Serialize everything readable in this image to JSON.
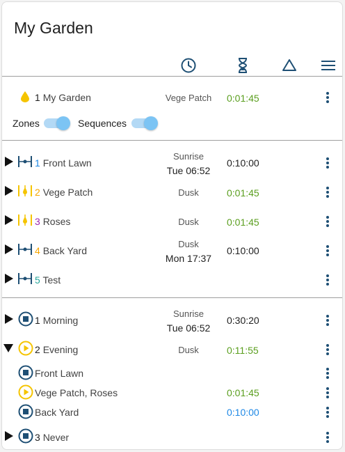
{
  "title": "My Garden",
  "header_icons": [
    "clock-icon",
    "hourglass-icon",
    "triangle-icon",
    "menu-icon"
  ],
  "controller": {
    "index": "1",
    "name": "My Garden",
    "status": "Vege Patch",
    "duration": "0:01:45",
    "zones_label": "Zones",
    "sequences_label": "Sequences"
  },
  "zones": [
    {
      "index": "1",
      "name": "Front Lawn",
      "line1": "Sunrise",
      "line2": "Tue 06:52",
      "duration": "0:10:00",
      "index_color": "#1e88e5",
      "icon": "zone-off-icon",
      "duration_color": "black"
    },
    {
      "index": "2",
      "name": "Vege Patch",
      "line1": "Dusk",
      "line2": "",
      "duration": "0:01:45",
      "index_color": "#f6a700",
      "icon": "zone-running-icon",
      "duration_color": "green"
    },
    {
      "index": "3",
      "name": "Roses",
      "line1": "Dusk",
      "line2": "",
      "duration": "0:01:45",
      "index_color": "#9c27b0",
      "icon": "zone-running-icon",
      "duration_color": "green"
    },
    {
      "index": "4",
      "name": "Back Yard",
      "line1": "Dusk",
      "line2": "Mon 17:37",
      "duration": "0:10:00",
      "index_color": "#f6a700",
      "icon": "zone-off-icon",
      "duration_color": "black"
    },
    {
      "index": "5",
      "name": "Test",
      "line1": "",
      "line2": "",
      "duration": "",
      "index_color": "#26a69a",
      "icon": "zone-off-icon",
      "duration_color": "black"
    }
  ],
  "sequences": [
    {
      "index": "1",
      "name": "Morning",
      "line1": "Sunrise",
      "line2": "Tue 06:52",
      "duration": "0:30:20",
      "icon": "stop-circle-icon",
      "duration_color": "black"
    },
    {
      "index": "2",
      "name": "Evening",
      "line1": "Dusk",
      "line2": "",
      "duration": "0:11:55",
      "icon": "play-circle-icon",
      "duration_color": "green"
    }
  ],
  "sequence_zones": [
    {
      "name": "Front Lawn",
      "duration": "",
      "icon": "stop-circle-icon",
      "duration_color": "black"
    },
    {
      "name": "Vege Patch, Roses",
      "duration": "0:01:45",
      "icon": "play-circle-icon",
      "duration_color": "green"
    },
    {
      "name": "Back Yard",
      "duration": "0:10:00",
      "icon": "stop-circle-icon",
      "duration_color": "blue"
    }
  ],
  "sequence_last": {
    "index": "3",
    "name": "Never",
    "icon": "stop-circle-icon"
  },
  "colors": {
    "accent_blue": "#1e4f74",
    "running_yellow": "#f5c400",
    "running_green": "#5a9e1e",
    "toggle_on": "#7cc4f4"
  }
}
